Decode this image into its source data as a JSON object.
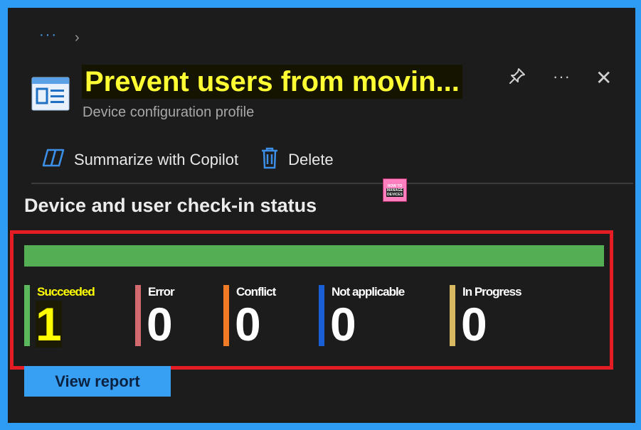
{
  "breadcrumb": {
    "more": "···",
    "chevron": "›"
  },
  "header": {
    "icon": "config-profile-icon",
    "title": "Prevent users from movin...",
    "subtitle": "Device configuration profile",
    "actions": [
      "pin-icon",
      "more-icon",
      "close-icon"
    ],
    "more_label": "···",
    "close_label": "✕"
  },
  "toolbar": {
    "copilot_label": "Summarize with Copilot",
    "copilot_icon": "copilot-icon",
    "delete_label": "Delete",
    "delete_icon": "trash-icon"
  },
  "logo": {
    "line1": "HOW TO",
    "line2": "MANAGE",
    "line3": "DEVICES"
  },
  "section": {
    "title": "Device and user check-in status"
  },
  "status_bar": {
    "color": "#54ae54",
    "succeeded_fraction": 1.0
  },
  "stats": [
    {
      "label": "Succeeded",
      "value": "1",
      "color": "#5cb85c",
      "label_color": "#ffff00",
      "value_color": "#ffff00",
      "highlighted": true
    },
    {
      "label": "Error",
      "value": "0",
      "color": "#d36a70",
      "label_color": "#ffffff",
      "value_color": "#ffffff"
    },
    {
      "label": "Conflict",
      "value": "0",
      "color": "#f07a25",
      "label_color": "#ffffff",
      "value_color": "#ffffff"
    },
    {
      "label": "Not applicable",
      "value": "0",
      "color": "#1a5fd6",
      "label_color": "#ffffff",
      "value_color": "#ffffff"
    },
    {
      "label": "In Progress",
      "value": "0",
      "color": "#d8b860",
      "label_color": "#ffffff",
      "value_color": "#ffffff"
    }
  ],
  "actions": {
    "view_report": "View report"
  },
  "colors": {
    "accent": "#38a0f2",
    "highlight_border": "#e31d23",
    "title_highlight": "#ffff33",
    "frame": "#2e9cf5"
  }
}
